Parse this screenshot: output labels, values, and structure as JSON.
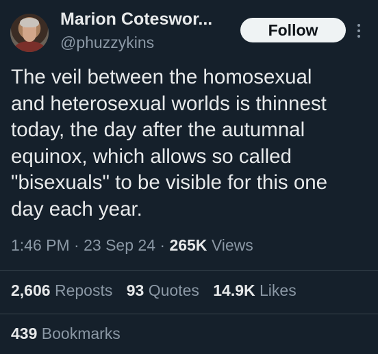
{
  "author": {
    "display_name": "Marion Coteswor...",
    "handle": "@phuzzykins"
  },
  "follow_label": "Follow",
  "tweet": {
    "lines": [
      "The veil between the homosexual",
      "and heterosexual worlds is thinnest",
      "today, the day after the autumnal",
      "equinox, which allows so called",
      "\"bisexuals\" to be visible for this one",
      "day each year."
    ]
  },
  "meta": {
    "time": "1:46 PM",
    "date": "23 Sep 24",
    "separator": "·",
    "views_count": "265K",
    "views_label": "Views"
  },
  "stats": {
    "reposts_count": "2,606",
    "reposts_label": "Reposts",
    "quotes_count": "93",
    "quotes_label": "Quotes",
    "likes_count": "14.9K",
    "likes_label": "Likes",
    "bookmarks_count": "439",
    "bookmarks_label": "Bookmarks"
  },
  "icons": {
    "more": "more-vertical-icon"
  },
  "colors": {
    "background": "#15202b",
    "text": "#e7e9ea",
    "muted": "#8b98a5",
    "divider": "#38444d",
    "follow_bg": "#eff3f4"
  }
}
